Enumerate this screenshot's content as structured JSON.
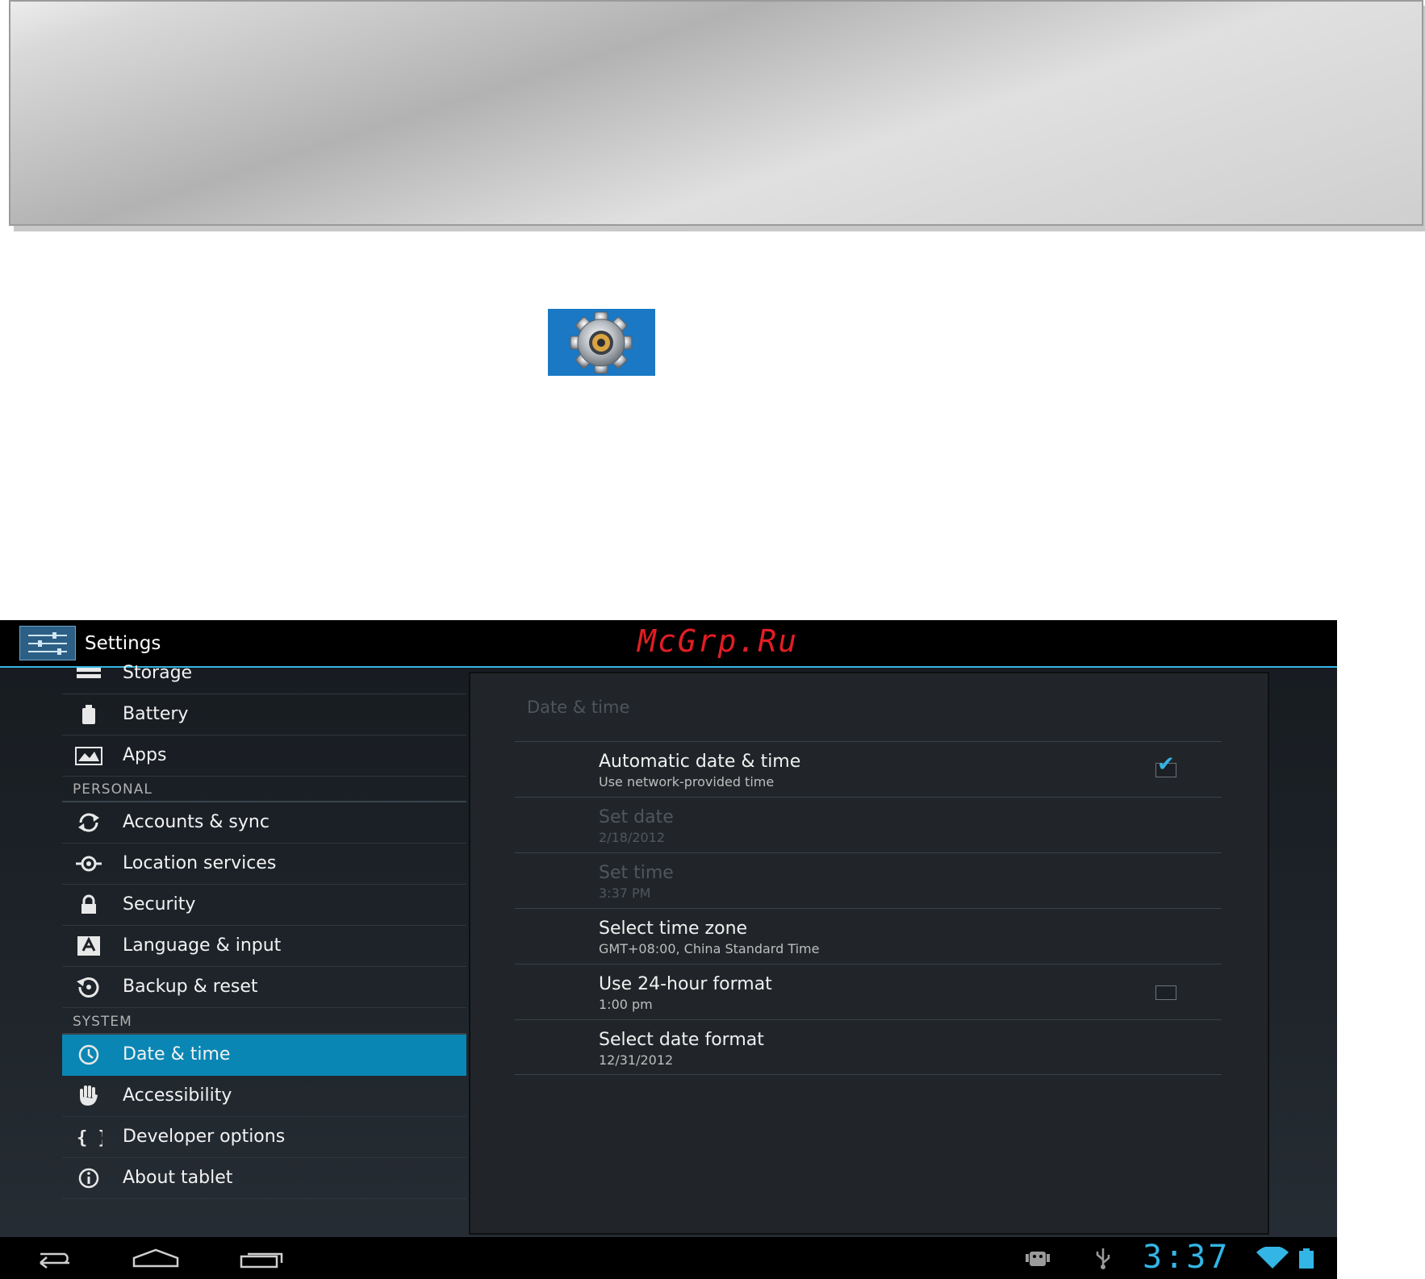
{
  "app": {
    "title": "Settings",
    "watermark": "McGrp.Ru"
  },
  "left_list": {
    "device_items": [
      {
        "label": "Storage",
        "icon": "storage-icon"
      },
      {
        "label": "Battery",
        "icon": "battery-icon"
      },
      {
        "label": "Apps",
        "icon": "apps-icon"
      }
    ],
    "personal_header": "PERSONAL",
    "personal_items": [
      {
        "label": "Accounts & sync",
        "icon": "sync-icon"
      },
      {
        "label": "Location services",
        "icon": "location-icon"
      },
      {
        "label": "Security",
        "icon": "lock-icon"
      },
      {
        "label": "Language & input",
        "icon": "language-icon"
      },
      {
        "label": "Backup & reset",
        "icon": "backup-icon"
      }
    ],
    "system_header": "SYSTEM",
    "system_items": [
      {
        "label": "Date & time",
        "icon": "clock-icon",
        "selected": true
      },
      {
        "label": "Accessibility",
        "icon": "hand-icon"
      },
      {
        "label": "Developer options",
        "icon": "braces-icon"
      },
      {
        "label": "About tablet",
        "icon": "info-icon"
      }
    ]
  },
  "detail": {
    "title": "Date & time",
    "prefs": [
      {
        "title": "Automatic date & time",
        "summary": "Use network-provided time",
        "checkbox": true,
        "checked": true,
        "enabled": true
      },
      {
        "title": "Set date",
        "summary": "2/18/2012",
        "enabled": false
      },
      {
        "title": "Set time",
        "summary": "3:37 PM",
        "enabled": false
      },
      {
        "title": "Select time zone",
        "summary": "GMT+08:00, China Standard Time",
        "enabled": true
      },
      {
        "title": "Use 24-hour format",
        "summary": "1:00 pm",
        "checkbox": true,
        "checked": false,
        "enabled": true
      },
      {
        "title": "Select date format",
        "summary": "12/31/2012",
        "enabled": true
      }
    ]
  },
  "statusbar": {
    "time": "3:37"
  },
  "colors": {
    "accent": "#33b5e5",
    "selected_row": "#0a86b4",
    "watermark": "#e21d24"
  }
}
